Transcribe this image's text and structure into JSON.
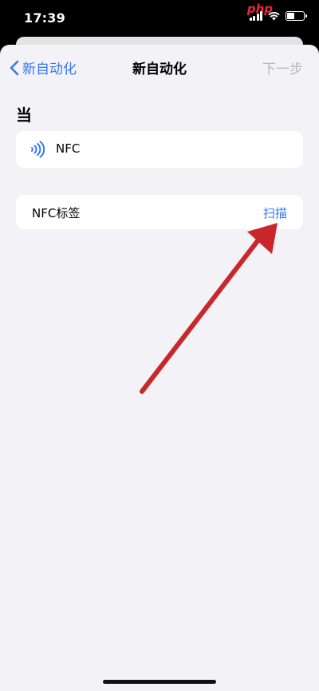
{
  "status": {
    "time": "17:39",
    "battery_level": 0.45
  },
  "watermark": {
    "text": "php"
  },
  "nav": {
    "back_label": "新自动化",
    "title": "新自动化",
    "next_label": "下一步"
  },
  "section": {
    "title": "当"
  },
  "trigger": {
    "icon": "nfc-icon",
    "label": "NFC"
  },
  "tag_row": {
    "label": "NFC标签",
    "action": "扫描"
  },
  "colors": {
    "accent": "#3478f6",
    "arrow": "#c9272c",
    "sheet_bg": "#f2f2f7",
    "disabled": "#b8b8bc"
  }
}
